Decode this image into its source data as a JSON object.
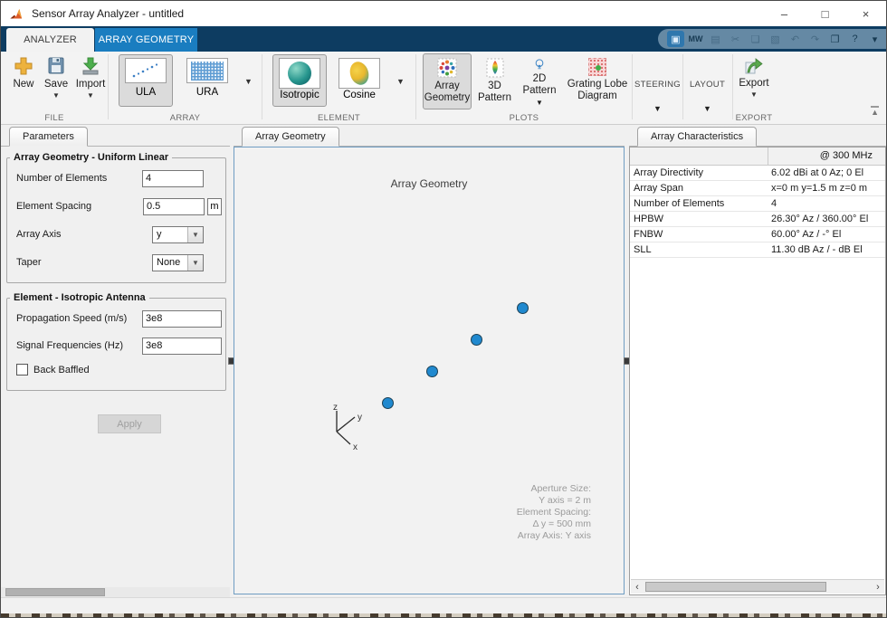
{
  "window": {
    "title": "Sensor Array Analyzer - untitled",
    "controls": {
      "minimize": "–",
      "maximize": "□",
      "close": "×"
    }
  },
  "tabstrip": {
    "analyzer_tab": "ANALYZER",
    "array_geometry_tab": "ARRAY GEOMETRY"
  },
  "quick_access": {
    "icons": [
      {
        "name": "desktop-icon",
        "glyph": "▣",
        "disabled": false,
        "first": true
      },
      {
        "name": "mathworks-icon",
        "glyph": "MW",
        "disabled": false
      },
      {
        "name": "save-icon",
        "glyph": "▤",
        "disabled": true
      },
      {
        "name": "cut-icon",
        "glyph": "✂",
        "disabled": true
      },
      {
        "name": "copy-icon",
        "glyph": "❏",
        "disabled": true
      },
      {
        "name": "paste-icon",
        "glyph": "▧",
        "disabled": true
      },
      {
        "name": "undo-icon",
        "glyph": "↶",
        "disabled": true
      },
      {
        "name": "redo-icon",
        "glyph": "↷",
        "disabled": true
      },
      {
        "name": "windows-icon",
        "glyph": "❐",
        "disabled": false
      },
      {
        "name": "help-icon",
        "glyph": "?",
        "disabled": false
      },
      {
        "name": "dropdown-icon",
        "glyph": "▾",
        "disabled": false
      }
    ]
  },
  "ribbon": {
    "file_group": {
      "label": "FILE",
      "new": "New",
      "save": "Save",
      "import": "Import"
    },
    "array_group": {
      "label": "ARRAY",
      "ula": "ULA",
      "ura": "URA"
    },
    "element_group": {
      "label": "ELEMENT",
      "isotropic": "Isotropic",
      "cosine": "Cosine"
    },
    "plots_group": {
      "label": "PLOTS",
      "array_geometry_line1": "Array",
      "array_geometry_line2": "Geometry",
      "pattern3d_line1": "3D",
      "pattern3d_line2": "Pattern",
      "pattern2d_line1": "2D",
      "pattern2d_line2": "Pattern",
      "grating_line1": "Grating Lobe",
      "grating_line2": "Diagram"
    },
    "steering_group": {
      "label": "STEERING"
    },
    "layout_group": {
      "label": "LAYOUT"
    },
    "export_group": {
      "label": "EXPORT",
      "export": "Export"
    }
  },
  "parameters": {
    "tab": "Parameters",
    "group1_title": "Array Geometry - Uniform Linear",
    "num_elements_label": "Number of Elements",
    "num_elements_value": "4",
    "spacing_label": "Element Spacing",
    "spacing_value": "0.5",
    "spacing_unit": "m",
    "axis_label": "Array Axis",
    "axis_value": "y",
    "taper_label": "Taper",
    "taper_value": "None",
    "group2_title": "Element - Isotropic Antenna",
    "speed_label": "Propagation Speed (m/s)",
    "speed_value": "3e8",
    "freq_label": "Signal Frequencies (Hz)",
    "freq_value": "3e8",
    "baffled_label": "Back Baffled",
    "apply_label": "Apply"
  },
  "plot": {
    "tab": "Array Geometry",
    "title": "Array Geometry",
    "axis": {
      "x": "x",
      "y": "y",
      "z": "z"
    },
    "marker_color": "#2089cf",
    "markers": [
      {
        "fx": 0.395,
        "fy": 0.573
      },
      {
        "fx": 0.509,
        "fy": 0.502
      },
      {
        "fx": 0.623,
        "fy": 0.431
      },
      {
        "fx": 0.74,
        "fy": 0.36
      }
    ],
    "annotation": [
      "Aperture Size:",
      "Y axis = 2 m",
      "Element Spacing:",
      "Δ y = 500 mm",
      "Array Axis: Y axis"
    ]
  },
  "characteristics": {
    "tab": "Array Characteristics",
    "column_header": "@ 300 MHz",
    "rows": [
      {
        "label": "Array Directivity",
        "value": "6.02 dBi at 0 Az; 0 El"
      },
      {
        "label": "Array Span",
        "value": "x=0 m y=1.5 m z=0 m"
      },
      {
        "label": "Number of Elements",
        "value": "4"
      },
      {
        "label": "HPBW",
        "value": "26.30° Az / 360.00° El"
      },
      {
        "label": "FNBW",
        "value": "60.00° Az / -° El"
      },
      {
        "label": "SLL",
        "value": "11.30 dB Az / - dB El"
      }
    ]
  }
}
